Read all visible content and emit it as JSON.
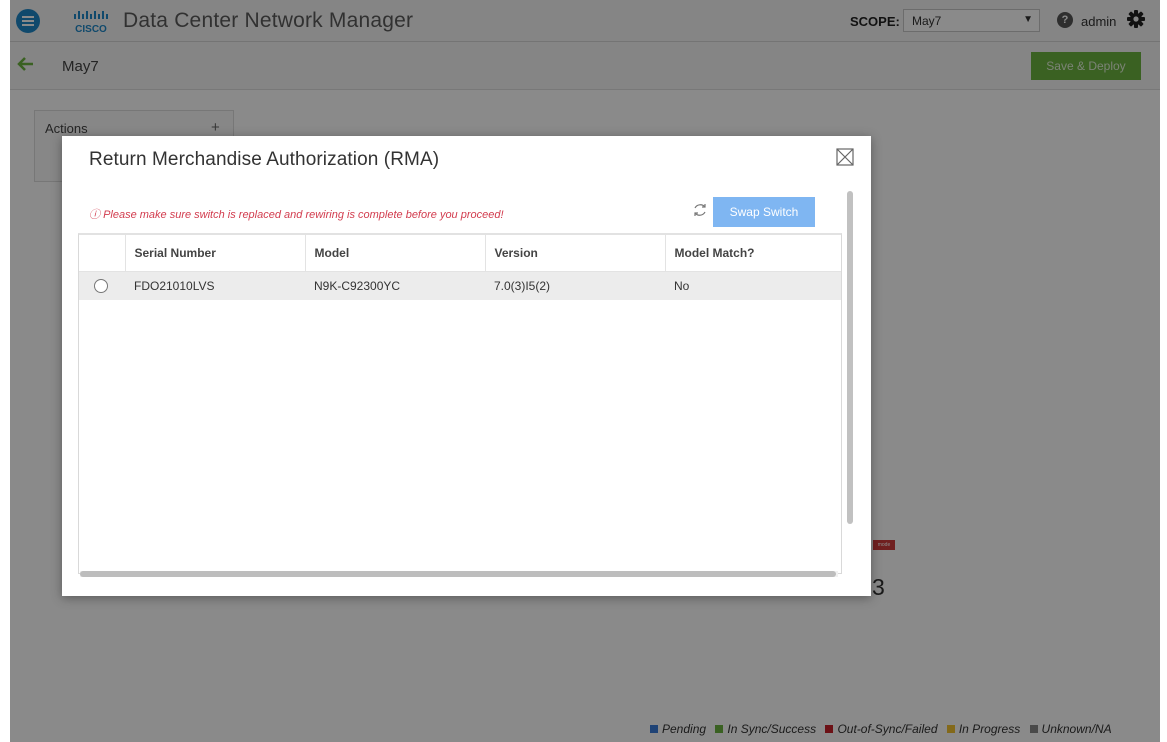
{
  "app": {
    "title": "Data Center Network Manager",
    "scope_label": "SCOPE:",
    "scope_value": "May7",
    "user": "admin"
  },
  "subbar": {
    "breadcrumb": "May7",
    "deploy_label": "Save & Deploy"
  },
  "actions": {
    "title": "Actions",
    "add_symbol": "+"
  },
  "background": {
    "badge_text": "mode",
    "partial_number": "3"
  },
  "legend": [
    {
      "label": "Pending",
      "color": "#3a7ddb"
    },
    {
      "label": "In Sync/Success",
      "color": "#6bb33f"
    },
    {
      "label": "Out-of-Sync/Failed",
      "color": "#c8202a"
    },
    {
      "label": "In Progress",
      "color": "#f2c230"
    },
    {
      "label": "Unknown/NA",
      "color": "#8a8a8a"
    }
  ],
  "modal": {
    "title": "Return Merchandise Authorization (RMA)",
    "warning_icon": "info-circle-icon",
    "warning": "Please make sure switch is replaced and rewiring is complete before you proceed!",
    "swap_label": "Swap Switch",
    "columns": [
      "",
      "Serial Number",
      "Model",
      "Version",
      "Model Match?"
    ],
    "rows": [
      {
        "serial": "FDO21010LVS",
        "model": "N9K-C92300YC",
        "version": "7.0(3)I5(2)",
        "match": "No",
        "selected": false
      }
    ]
  },
  "colors": {
    "accent_blue": "#1e88c8",
    "deploy_green": "#6bb33f",
    "swap_blue": "#7fb6f2",
    "warning_red": "#d23c4e"
  }
}
